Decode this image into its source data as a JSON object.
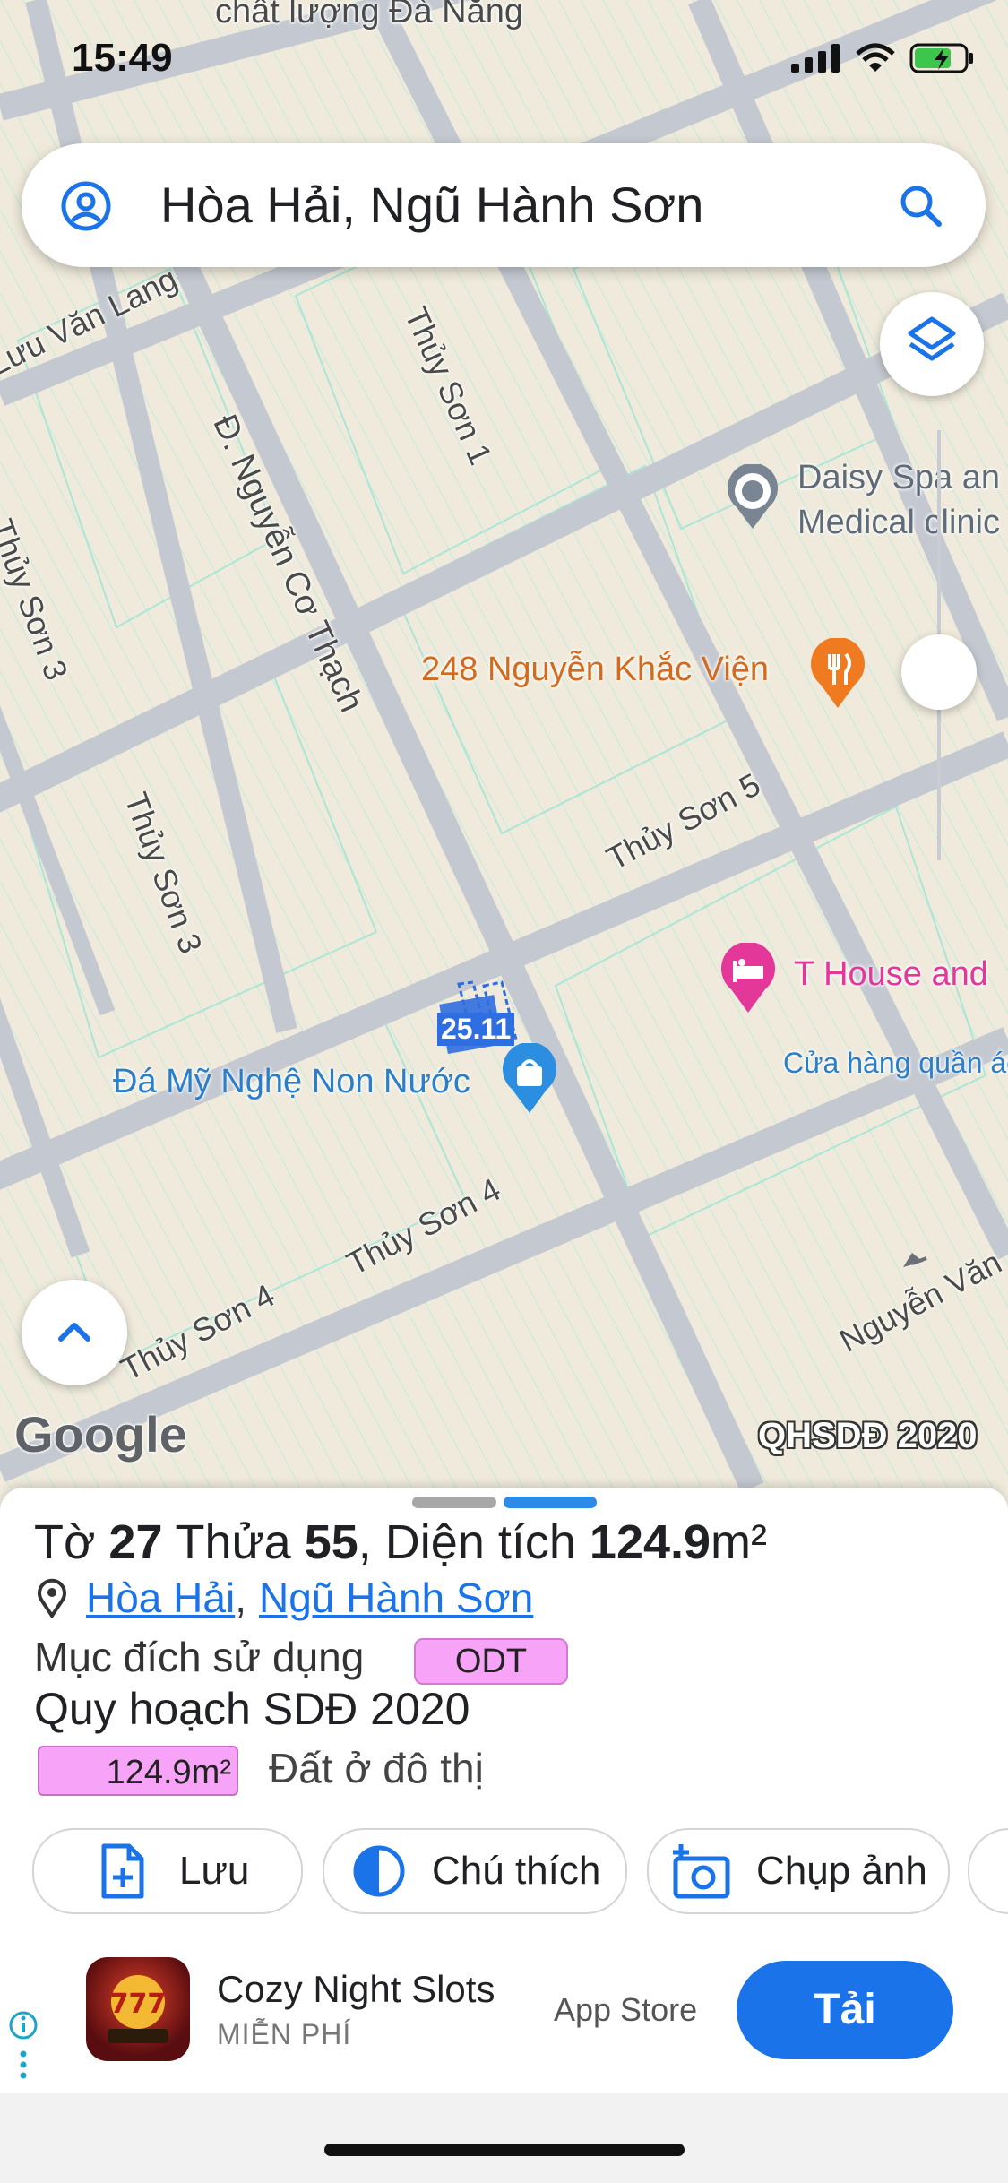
{
  "status": {
    "time": "15:49"
  },
  "search": {
    "text": "Hòa Hải, Ngũ Hành Sơn"
  },
  "map": {
    "top_label": "chất lượng Đà Nẵng",
    "roads": [
      "Lưu Văn Lang",
      "Thủy Sơn 1",
      "Đ. Nguyễn Cơ Thạch",
      "Thủy Sơn 3",
      "Thủy Sơn 3",
      "Thủy Sơn 5",
      "Thủy Sơn 4",
      "Thủy Sơn 4",
      "Nguyễn Văn",
      "Cửa hàng quần áo"
    ],
    "poi": {
      "daisy_line1": "Daisy Spa an",
      "daisy_line2": "Medical clinic",
      "restaurant": "248 Nguyễn Khắc Viện",
      "hotel": "T House and",
      "shop": "Đá Mỹ Nghệ Non Nước",
      "parcel_label": "25.11"
    },
    "google_logo": "Google",
    "watermark": "QHSDĐ 2020"
  },
  "sheet": {
    "title_prefix": "Tờ ",
    "to_num": "27",
    "thua_word": " Thửa ",
    "thua_num": "55",
    "area_word": ", Diện tích ",
    "area_num": "124.9",
    "area_unit": "m²",
    "location_1": "Hòa Hải",
    "location_sep": ",",
    "location_2": "Ngũ Hành Sơn",
    "purpose_label": "Mục đích sử dụng",
    "purpose_badge": "ODT",
    "plan_title": "Quy hoạch SDĐ 2020",
    "plan_area": "124.9m²",
    "plan_desc": "Đất ở đô thị",
    "odt_color": "#f7a3f7"
  },
  "actions": {
    "save": "Lưu",
    "legend": "Chú thích",
    "photo": "Chụp ảnh"
  },
  "ad": {
    "app_name": "Cozy Night Slots",
    "price": "MIỄN PHÍ",
    "store": "App Store",
    "cta": "Tải"
  }
}
